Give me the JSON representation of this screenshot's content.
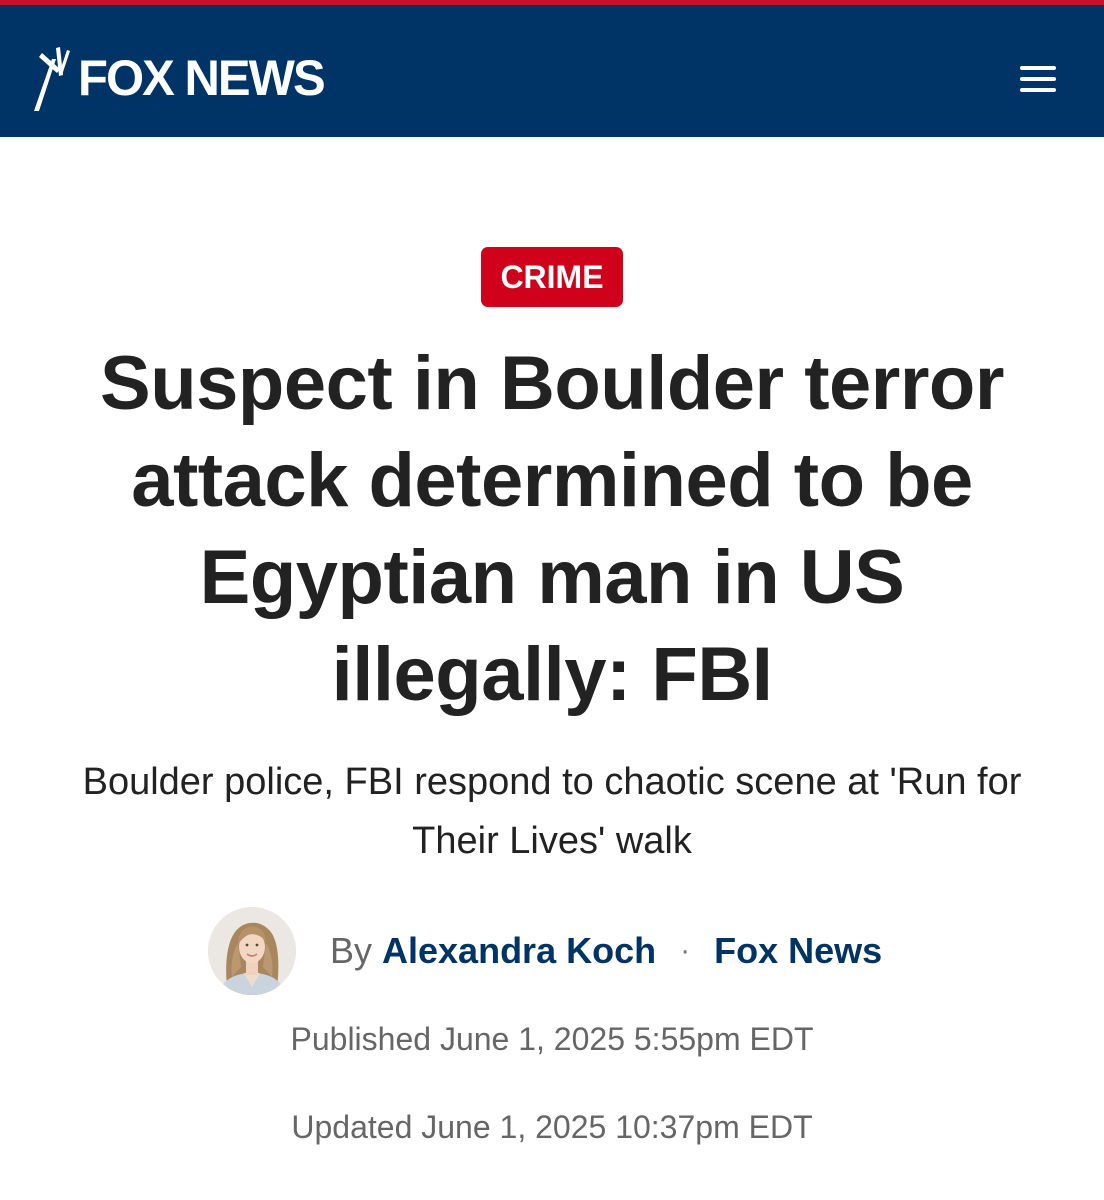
{
  "header": {
    "logo_text": "FOX NEWS",
    "menu_icon": "hamburger-menu-icon",
    "colors": {
      "bar": "#003366",
      "accent_stripe": "#c8102e"
    }
  },
  "article": {
    "category": "CRIME",
    "category_color": "#d0021b",
    "headline": "Suspect in Boulder terror attack determined to be Egyptian man in US illegally: FBI",
    "subheadline": "Boulder police, FBI respond to chaotic scene at 'Run for Their Lives' walk",
    "byline": {
      "by_label": "By",
      "author": "Alexandra Koch",
      "separator": "·",
      "source": "Fox News",
      "link_color": "#003366"
    },
    "published": "Published June 1, 2025 5:55pm EDT",
    "updated": "Updated June 1, 2025 10:37pm EDT"
  }
}
